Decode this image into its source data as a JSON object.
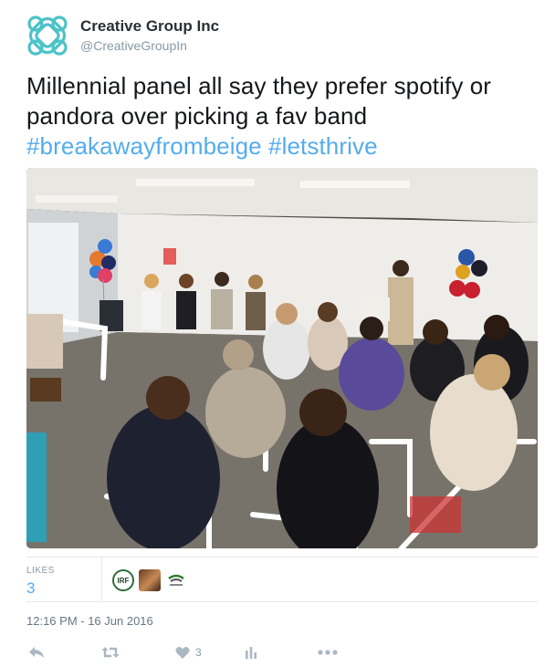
{
  "account": {
    "display_name": "Creative Group Inc",
    "handle": "@CreativeGroupIn",
    "avatar_icon": "celtic-knot-logo",
    "brand_color": "#4cc3c8"
  },
  "tweet": {
    "text_line1": "Millennial panel all say they prefer spotify or",
    "text_line2": "pandora over picking a fav band",
    "hashtag1": "#breakawayfrombeige",
    "hashtag2": "#letsthrive",
    "link_color": "#55acee"
  },
  "stats": {
    "likes_label": "LIKES",
    "likes_count": "3",
    "liker_avatars": [
      "IRF",
      "profile-photo",
      "green-logo"
    ]
  },
  "timestamp": "12:16 PM - 16 Jun 2016",
  "actions": {
    "reply_icon": "reply-icon",
    "retweet_icon": "retweet-icon",
    "like_icon": "heart-icon",
    "like_count": "3",
    "analytics_icon": "analytics-icon",
    "more_icon": "more-icon"
  }
}
